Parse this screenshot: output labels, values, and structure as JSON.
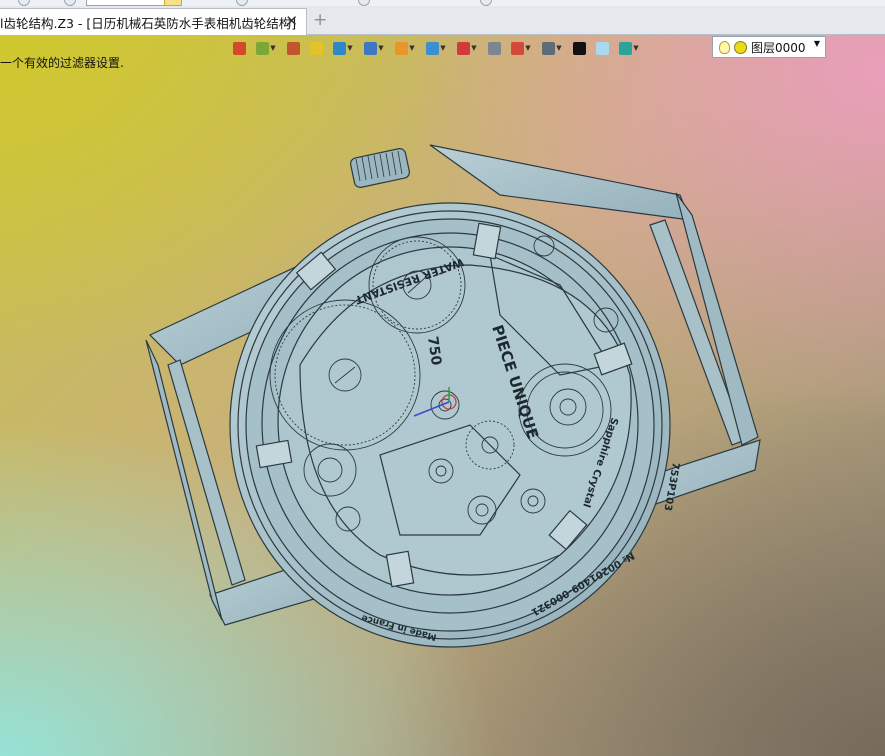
{
  "document_tab": {
    "title": "l齿轮结构.Z3 - [日历机械石英防水手表相机齿轮结构]",
    "close_glyph": "✕"
  },
  "new_tab_glyph": "+",
  "status_message": "一个有效的过滤器设置.",
  "layer": {
    "name": "图层0000"
  },
  "toolbar": {
    "buttons": [
      {
        "name": "exit-icon",
        "color": "#d24a2a",
        "dropdown": false
      },
      {
        "name": "tree-icon",
        "color": "#7aa63a",
        "dropdown": true
      },
      {
        "name": "sketch-pen-icon",
        "color": "#c2542e",
        "dropdown": false
      },
      {
        "name": "shape-box-icon",
        "color": "#e3c22a",
        "dropdown": false
      },
      {
        "name": "solid-view-icon",
        "color": "#2e87c9",
        "dropdown": true
      },
      {
        "name": "display-mode-icon",
        "color": "#3d78c4",
        "dropdown": true
      },
      {
        "name": "filter-icon",
        "color": "#e8962a",
        "dropdown": true
      },
      {
        "name": "view-frame-icon",
        "color": "#3c8fd0",
        "dropdown": true
      },
      {
        "name": "origin-icon",
        "color": "#d03a3a",
        "dropdown": true
      },
      {
        "name": "section-icon",
        "color": "#7b8692",
        "dropdown": false
      },
      {
        "name": "dimension-icon",
        "color": "#d14a3a",
        "dropdown": true
      },
      {
        "name": "render-icon",
        "color": "#5e6b78",
        "dropdown": true
      },
      {
        "name": "line-color-icon",
        "color": "#111111",
        "dropdown": false
      },
      {
        "name": "background-color-icon",
        "color": "#a9d9ef",
        "dropdown": false
      },
      {
        "name": "layer-manager-icon",
        "color": "#2aa39a",
        "dropdown": true
      }
    ]
  },
  "model": {
    "engravings": {
      "water_resistant": "WATER RESISTANT",
      "piece_unique": "PIECE UNIQUE",
      "hallmark": "750",
      "crystal": "Sapphire Crystal",
      "ref": "753P103",
      "serial": "№ 0020140​9-000321",
      "origin": "Made in France"
    },
    "colors": {
      "body": "#a9c3cc",
      "outline": "#2b3a40"
    }
  }
}
